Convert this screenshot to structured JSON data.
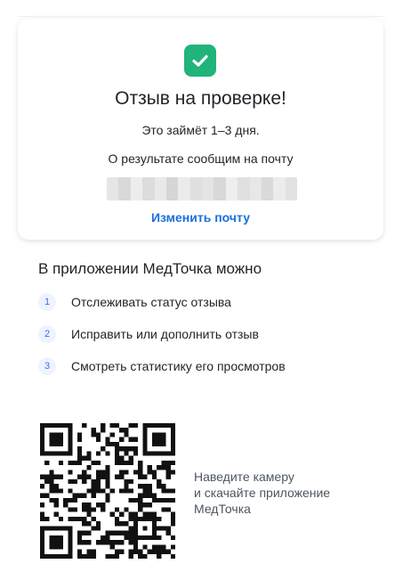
{
  "colors": {
    "success": "#20b37a",
    "link": "#1a6fe0",
    "badge_bg": "#eef3ff",
    "badge_text": "#3a6ff0"
  },
  "status_card": {
    "icon": "check-icon",
    "title": "Отзыв на проверке!",
    "subtitle": "Это займёт 1–3 дня.",
    "notify_text": "О результате сообщим на почту",
    "change_email_label": "Изменить почту"
  },
  "app_section": {
    "heading": "В приложении МедТочка можно",
    "features": [
      {
        "number": "1",
        "text": "Отслеживать статус отзыва"
      },
      {
        "number": "2",
        "text": "Исправить или дополнить отзыв"
      },
      {
        "number": "3",
        "text": "Смотреть статистику его просмотров"
      }
    ]
  },
  "qr_block": {
    "icon": "qr-code-icon",
    "caption_lines": [
      "Наведите камеру",
      "и скачайте приложение",
      "МедТочка"
    ]
  }
}
